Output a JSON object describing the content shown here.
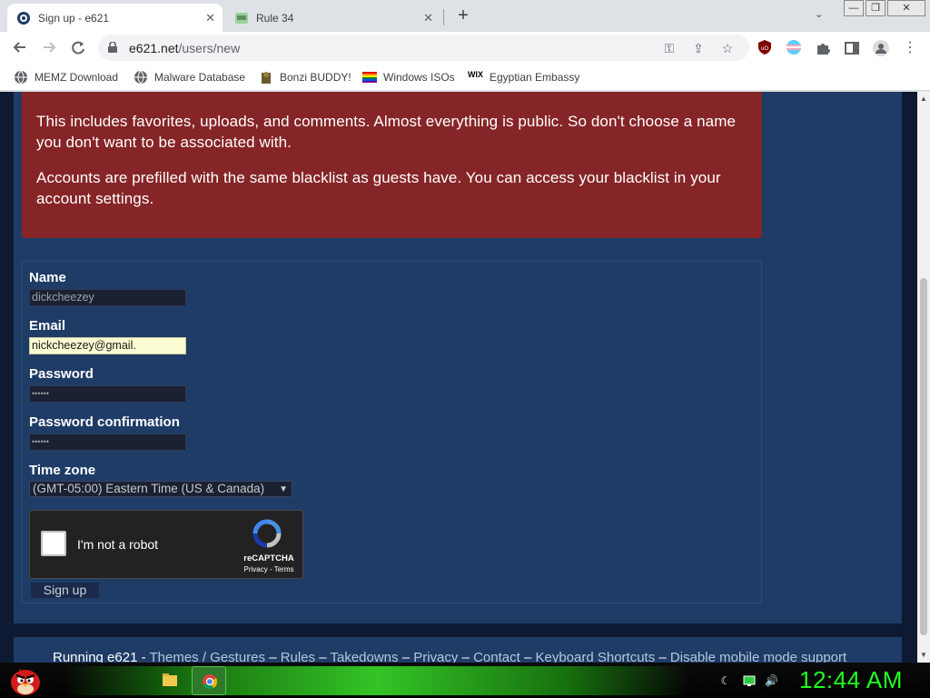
{
  "browser": {
    "tabs": [
      {
        "title": "Sign up - e621",
        "active": true,
        "close": "✕"
      },
      {
        "title": "Rule 34",
        "active": false,
        "close": "✕"
      }
    ],
    "new_tab": "+",
    "tab_menu": "⌄",
    "window_controls": [
      "—",
      "❐",
      "✕"
    ],
    "url_host": "e621.net",
    "url_path": "/users/new",
    "bookmarks": [
      "MEMZ Download",
      "Malware Database",
      "Bonzi BUDDY!",
      "Windows ISOs",
      "Egyptian Embassy"
    ],
    "accent_color": "#1a73e8"
  },
  "page": {
    "notice_paragraphs": [
      "This includes favorites, uploads, and comments. Almost everything is public. So don't choose a name you don't want to be associated with.",
      "Accounts are prefilled with the same blacklist as guests have. You can access your blacklist in your account settings."
    ],
    "form": {
      "name_label": "Name",
      "name_value": "dickcheezey",
      "email_label": "Email",
      "email_value": "nickcheezey@gmail.",
      "password_label": "Password",
      "password_value": "••••••",
      "password_confirm_label": "Password confirmation",
      "password_confirm_value": "••••••",
      "timezone_label": "Time zone",
      "timezone_value": "(GMT-05:00) Eastern Time (US & Canada)",
      "captcha_text": "I'm not a robot",
      "captcha_brand": "reCAPTCHA",
      "captcha_links": "Privacy - Terms",
      "submit_label": "Sign up"
    },
    "footer": {
      "prefix": "Running e621 - ",
      "links": [
        "Themes / Gestures",
        "Rules",
        "Takedowns",
        "Privacy",
        "Contact",
        "Keyboard Shortcuts",
        "Disable mobile mode support"
      ],
      "separator": " – "
    },
    "colors": {
      "notice_bg": "#862527",
      "page_bg": "#1f3c67",
      "outer_bg": "#0e1a33"
    }
  },
  "taskbar": {
    "clock": "12:44 AM",
    "clock_color": "#21ff21"
  }
}
